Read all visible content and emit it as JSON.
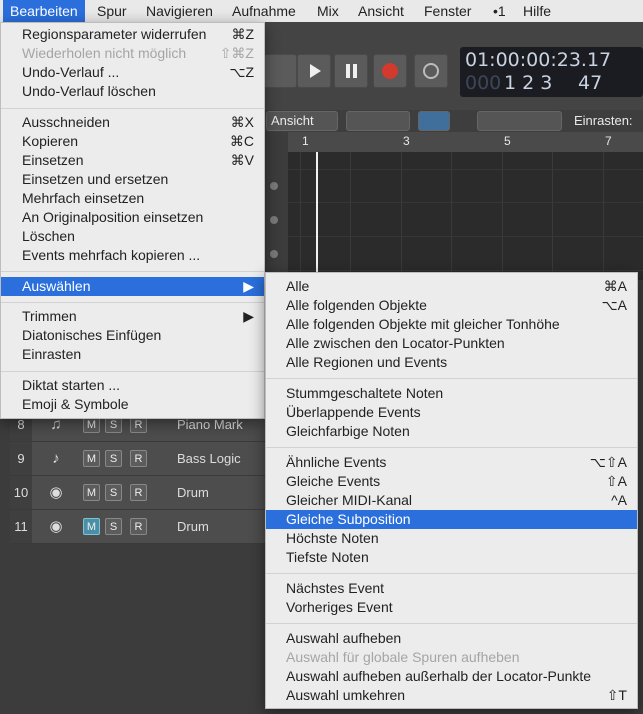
{
  "menubar": {
    "items": [
      "Bearbeiten",
      "Spur",
      "Navigieren",
      "Aufnahme",
      "Mix",
      "Ansicht",
      "Fenster",
      "•1",
      "Hilfe"
    ]
  },
  "transport": {
    "time_display": "01:00:00:23.17",
    "time_display_dim": "000",
    "bar_beat": "1  2  3",
    "subdiv": "47"
  },
  "toolbar": {
    "view_label": "Ansicht",
    "snap_label": "Einrasten:"
  },
  "ruler": {
    "ticks": [
      "1",
      "3",
      "5",
      "7"
    ]
  },
  "tracks": [
    {
      "number": "8",
      "icon": "piano-icon",
      "name": "Piano Mark",
      "m": "M",
      "s": "S",
      "r": "R"
    },
    {
      "number": "9",
      "icon": "violin-icon",
      "name": "Bass Logic",
      "m": "M",
      "s": "S",
      "r": "R"
    },
    {
      "number": "10",
      "icon": "drum-icon",
      "name": "Drum",
      "m": "M",
      "s": "S",
      "r": "R"
    },
    {
      "number": "11",
      "icon": "drum-icon",
      "name": "Drum",
      "m": "M",
      "s": "S",
      "r": "R",
      "mute_on": true
    }
  ],
  "edit_menu": {
    "items": [
      {
        "label": "Regionsparameter widerrufen",
        "shortcut": "⌘Z"
      },
      {
        "label": "Wiederholen nicht möglich",
        "shortcut": "⇧⌘Z",
        "disabled": true
      },
      {
        "label": "Undo-Verlauf ...",
        "shortcut": "⌥Z"
      },
      {
        "label": "Undo-Verlauf löschen",
        "shortcut": ""
      },
      {
        "label": "Ausschneiden",
        "shortcut": "⌘X"
      },
      {
        "label": "Kopieren",
        "shortcut": "⌘C"
      },
      {
        "label": "Einsetzen",
        "shortcut": "⌘V"
      },
      {
        "label": "Einsetzen und ersetzen",
        "shortcut": ""
      },
      {
        "label": "Mehrfach einsetzen",
        "shortcut": ""
      },
      {
        "label": "An Originalposition einsetzen",
        "shortcut": ""
      },
      {
        "label": "Löschen",
        "shortcut": ""
      },
      {
        "label": "Events mehrfach kopieren ...",
        "shortcut": ""
      },
      {
        "label": "Auswählen",
        "shortcut": "▶",
        "selected": true
      },
      {
        "label": "Trimmen",
        "shortcut": "▶"
      },
      {
        "label": "Diatonisches Einfügen",
        "shortcut": ""
      },
      {
        "label": "Einrasten",
        "shortcut": ""
      },
      {
        "label": "Diktat starten ...",
        "shortcut": ""
      },
      {
        "label": "Emoji & Symbole",
        "shortcut": ""
      }
    ]
  },
  "select_submenu": {
    "items": [
      {
        "label": "Alle",
        "shortcut": "⌘A"
      },
      {
        "label": "Alle folgenden Objekte",
        "shortcut": "⌥A"
      },
      {
        "label": "Alle folgenden Objekte mit gleicher Tonhöhe",
        "shortcut": ""
      },
      {
        "label": "Alle zwischen den Locator-Punkten",
        "shortcut": ""
      },
      {
        "label": "Alle Regionen und Events",
        "shortcut": ""
      },
      {
        "label": "Stummgeschaltete Noten",
        "shortcut": ""
      },
      {
        "label": "Überlappende Events",
        "shortcut": ""
      },
      {
        "label": "Gleichfarbige Noten",
        "shortcut": ""
      },
      {
        "label": "Ähnliche Events",
        "shortcut": "⌥⇧A"
      },
      {
        "label": "Gleiche Events",
        "shortcut": "⇧A"
      },
      {
        "label": "Gleicher MIDI-Kanal",
        "shortcut": "^A"
      },
      {
        "label": "Gleiche Subposition",
        "shortcut": "",
        "selected": true
      },
      {
        "label": "Höchste Noten",
        "shortcut": ""
      },
      {
        "label": "Tiefste Noten",
        "shortcut": ""
      },
      {
        "label": "Nächstes Event",
        "shortcut": ""
      },
      {
        "label": "Vorheriges Event",
        "shortcut": ""
      },
      {
        "label": "Auswahl aufheben",
        "shortcut": ""
      },
      {
        "label": "Auswahl für globale Spuren aufheben",
        "shortcut": "",
        "disabled": true
      },
      {
        "label": "Auswahl aufheben außerhalb der Locator-Punkte",
        "shortcut": ""
      },
      {
        "label": "Auswahl umkehren",
        "shortcut": "⇧T"
      }
    ]
  },
  "colors": {
    "accent": "#2a6fdb",
    "menu_bg": "#ececec",
    "app_bg": "#3c3c3c"
  }
}
